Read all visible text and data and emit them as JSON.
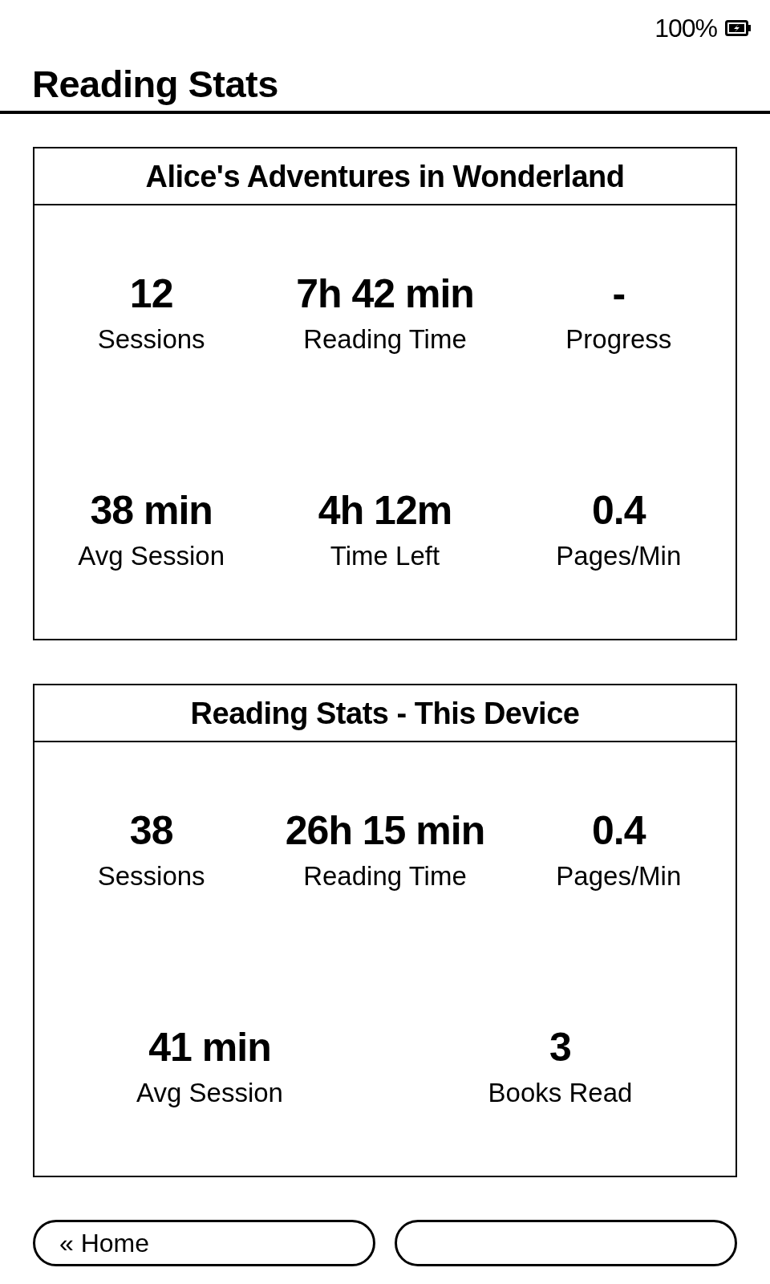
{
  "status_bar": {
    "battery": "100%"
  },
  "title": "Reading Stats",
  "cards": [
    {
      "title": "Alice's Adventures in Wonderland",
      "rows": [
        [
          {
            "value": "12",
            "label": "Sessions"
          },
          {
            "value": "7h 42 min",
            "label": "Reading Time"
          },
          {
            "value": "-",
            "label": "Progress"
          }
        ],
        [
          {
            "value": "38 min",
            "label": "Avg Session"
          },
          {
            "value": "4h 12m",
            "label": "Time Left"
          },
          {
            "value": "0.4",
            "label": "Pages/Min"
          }
        ]
      ]
    },
    {
      "title": "Reading Stats - This Device",
      "rows": [
        [
          {
            "value": "38",
            "label": "Sessions"
          },
          {
            "value": "26h 15 min",
            "label": "Reading Time"
          },
          {
            "value": "0.4",
            "label": "Pages/Min"
          }
        ],
        [
          {
            "value": "41 min",
            "label": "Avg Session"
          },
          {
            "value": "3",
            "label": "Books Read"
          }
        ]
      ]
    }
  ],
  "buttons": [
    {
      "kind": "labeled",
      "label": "« Home"
    },
    {
      "kind": "blank"
    }
  ]
}
